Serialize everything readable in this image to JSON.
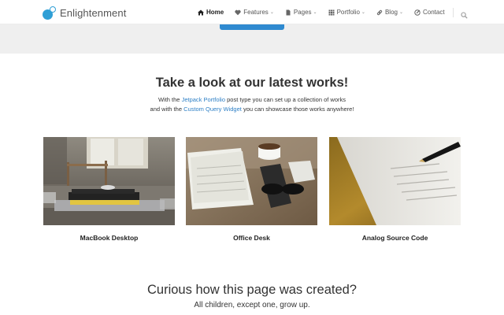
{
  "header": {
    "logo_text": "Enlightenment",
    "nav": [
      {
        "label": "Home",
        "icon": "home-icon",
        "active": true,
        "dropdown": false
      },
      {
        "label": "Features",
        "icon": "heart-icon",
        "active": false,
        "dropdown": true
      },
      {
        "label": "Pages",
        "icon": "page-icon",
        "active": false,
        "dropdown": true
      },
      {
        "label": "Portfolio",
        "icon": "grid-icon",
        "active": false,
        "dropdown": true
      },
      {
        "label": "Blog",
        "icon": "link-icon",
        "active": false,
        "dropdown": true
      },
      {
        "label": "Contact",
        "icon": "edit-icon",
        "active": false,
        "dropdown": false
      }
    ]
  },
  "works": {
    "title": "Take a look at our latest works!",
    "desc_line1_pre": "With the ",
    "desc_line1_link": "Jetpack Portfolio",
    "desc_line1_post": " post type you can set up a collection of works",
    "desc_line2_pre": "and with the ",
    "desc_line2_link": "Custom Query Widget",
    "desc_line2_post": " you can showcase those works anywhere!",
    "items": [
      {
        "title": "MacBook Desktop"
      },
      {
        "title": "Office Desk"
      },
      {
        "title": "Analog Source Code"
      }
    ]
  },
  "curious": {
    "title": "Curious how this page was created?",
    "subtitle": "All children, except one, grow up."
  },
  "colors": {
    "accent": "#2f8ad0",
    "link": "#2f80c6",
    "band": "#efefef"
  }
}
